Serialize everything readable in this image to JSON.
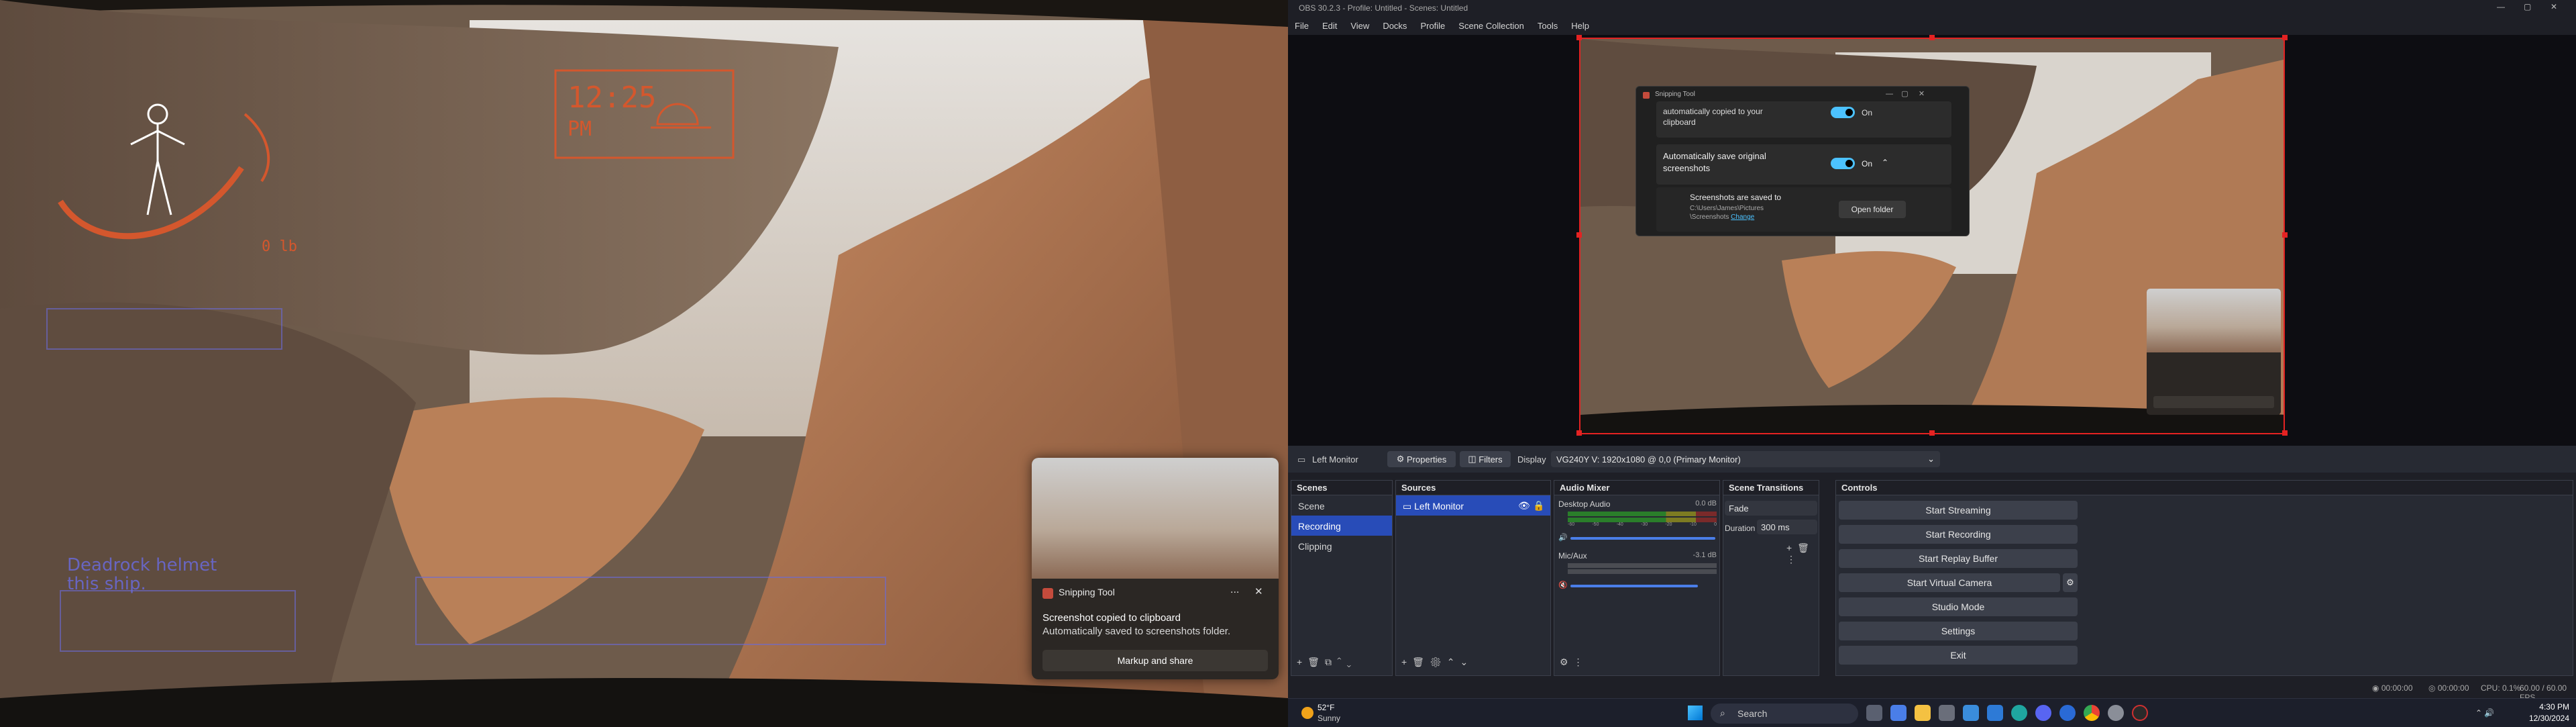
{
  "game": {
    "clock": "12:25",
    "clock_period": "PM",
    "weight": "0  lb",
    "npc_text_line1": "Deadrock helmet",
    "npc_text_line2": "this ship."
  },
  "snipping_toast": {
    "title": "Snipping Tool",
    "line1": "Screenshot copied to clipboard",
    "line2": "Automatically saved to screenshots folder.",
    "button": "Markup and share",
    "more": "...",
    "close": "✕"
  },
  "obs": {
    "window_title": "OBS 30.2.3 - Profile: Untitled - Scenes: Untitled",
    "menu": [
      "File",
      "Edit",
      "View",
      "Docks",
      "Profile",
      "Scene Collection",
      "Tools",
      "Help"
    ],
    "preview_snip": {
      "title": "Snipping Tool",
      "row1_text1": "automatically copied to your",
      "row1_text2": "clipboard",
      "row1_state": "On",
      "row2_text1": "Automatically save original",
      "row2_text2": "screenshots",
      "row2_state": "On",
      "saved_to": "Screenshots are saved to",
      "path1": "C:\\Users\\James\\Pictures",
      "path2": "\\Screenshots",
      "change": "Change",
      "open_folder": "Open folder"
    },
    "source_bar": {
      "source_name": "Left Monitor",
      "properties": "Properties",
      "filters": "Filters",
      "display_label": "Display",
      "display_value": "VG240Y V: 1920x1080 @ 0,0 (Primary Monitor)"
    },
    "scenes": {
      "title": "Scenes",
      "items": [
        "Scene",
        "Recording",
        "Clipping"
      ]
    },
    "sources": {
      "title": "Sources",
      "items": [
        "Left Monitor"
      ]
    },
    "audio_mixer": {
      "title": "Audio Mixer",
      "channels": [
        {
          "name": "Desktop Audio",
          "db": "0.0 dB"
        },
        {
          "name": "Mic/Aux",
          "db": "-3.1 dB"
        }
      ],
      "scale": [
        "-60",
        "-55",
        "-50",
        "-45",
        "-40",
        "-35",
        "-30",
        "-25",
        "-20",
        "-15",
        "-10",
        "-5",
        "0"
      ]
    },
    "transitions": {
      "title": "Scene Transitions",
      "type": "Fade",
      "duration_label": "Duration",
      "duration_value": "300 ms"
    },
    "controls": {
      "title": "Controls",
      "buttons": [
        "Start Streaming",
        "Start Recording",
        "Start Replay Buffer",
        "Start Virtual Camera",
        "Studio Mode",
        "Settings",
        "Exit"
      ]
    },
    "status": {
      "rec_time": "00:00:00",
      "stream_time": "00:00:00",
      "cpu": "CPU: 0.1%",
      "fps": "60.00 / 60.00 FPS"
    }
  },
  "taskbar": {
    "weather_temp": "52°F",
    "weather_cond": "Sunny",
    "search": "Search",
    "time": "4:30 PM",
    "date": "12/30/2024"
  }
}
